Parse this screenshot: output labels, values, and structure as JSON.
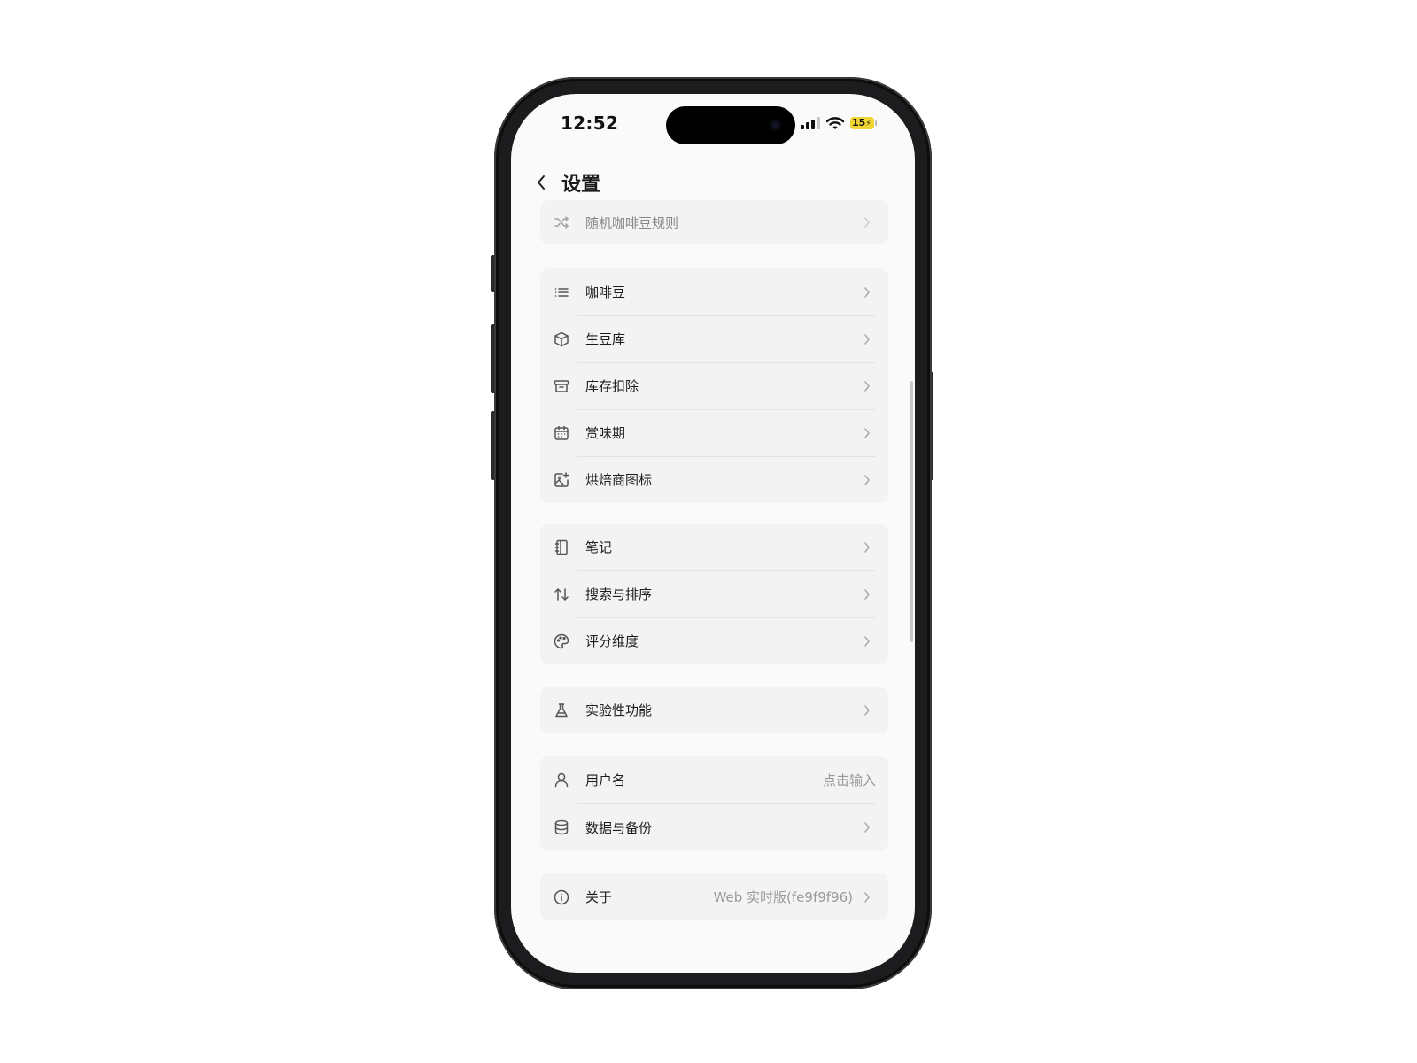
{
  "status_bar": {
    "time": "12:52",
    "battery": "15"
  },
  "header": {
    "title": "设置"
  },
  "groups": [
    [
      {
        "icon": "shuffle-icon",
        "label": "随机咖啡豆规则",
        "value": ""
      }
    ],
    [
      {
        "icon": "list-icon",
        "label": "咖啡豆",
        "value": ""
      },
      {
        "icon": "box-icon",
        "label": "生豆库",
        "value": ""
      },
      {
        "icon": "archive-icon",
        "label": "库存扣除",
        "value": ""
      },
      {
        "icon": "calendar-icon",
        "label": "赏味期",
        "value": ""
      },
      {
        "icon": "image-plus-icon",
        "label": "烘焙商图标",
        "value": ""
      }
    ],
    [
      {
        "icon": "notebook-icon",
        "label": "笔记",
        "value": ""
      },
      {
        "icon": "sort-arrows-icon",
        "label": "搜索与排序",
        "value": ""
      },
      {
        "icon": "palette-icon",
        "label": "评分维度",
        "value": ""
      }
    ],
    [
      {
        "icon": "flask-icon",
        "label": "实验性功能",
        "value": ""
      }
    ],
    [
      {
        "icon": "user-icon",
        "label": "用户名",
        "value": "点击输入"
      },
      {
        "icon": "database-icon",
        "label": "数据与备份",
        "value": ""
      }
    ],
    [
      {
        "icon": "info-icon",
        "label": "关于",
        "value": "Web 实时版(fe9f9f96)"
      }
    ]
  ]
}
